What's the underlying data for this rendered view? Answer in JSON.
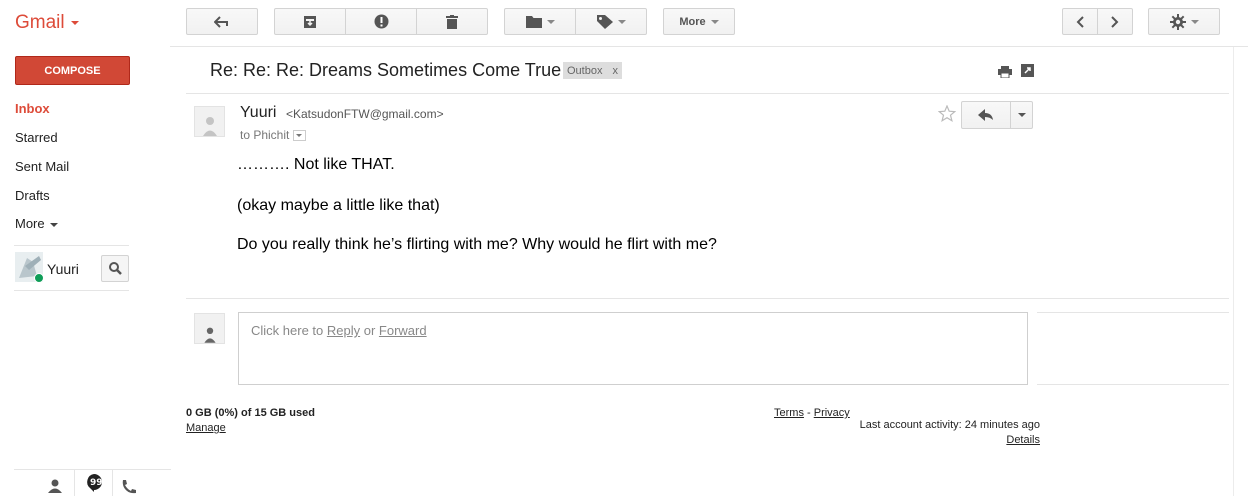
{
  "app": {
    "logo_text": "Gmail"
  },
  "toolbar": {
    "more_label": "More"
  },
  "compose_label": "COMPOSE",
  "sidebar": {
    "items": [
      {
        "label": "Inbox",
        "active": true
      },
      {
        "label": "Starred"
      },
      {
        "label": "Sent Mail"
      },
      {
        "label": "Drafts"
      },
      {
        "label": "More"
      }
    ],
    "chat_user": "Yuuri"
  },
  "message": {
    "subject": "Re: Re: Re: Dreams Sometimes Come True",
    "label": "Outbox",
    "label_remove": "x",
    "sender_name": "Yuuri",
    "sender_email": "<KatsudonFTW@gmail.com>",
    "to_line": "to Phichit",
    "body": [
      "………. Not like THAT.",
      "(okay maybe a little like that)",
      "Do you really think he’s flirting with me?  Why would he flirt with me?"
    ]
  },
  "reply": {
    "prefix": "Click here to ",
    "reply_link": "Reply",
    "middle": " or ",
    "forward_link": "Forward"
  },
  "footer": {
    "storage": "0 GB (0%) of 15 GB used",
    "manage": "Manage",
    "terms": "Terms",
    "dash": " - ",
    "privacy": "Privacy",
    "activity": "Last account activity: 24 minutes ago",
    "details": "Details"
  },
  "colors": {
    "brand_red": "#dd4b39",
    "compose_bg": "#d14836"
  }
}
